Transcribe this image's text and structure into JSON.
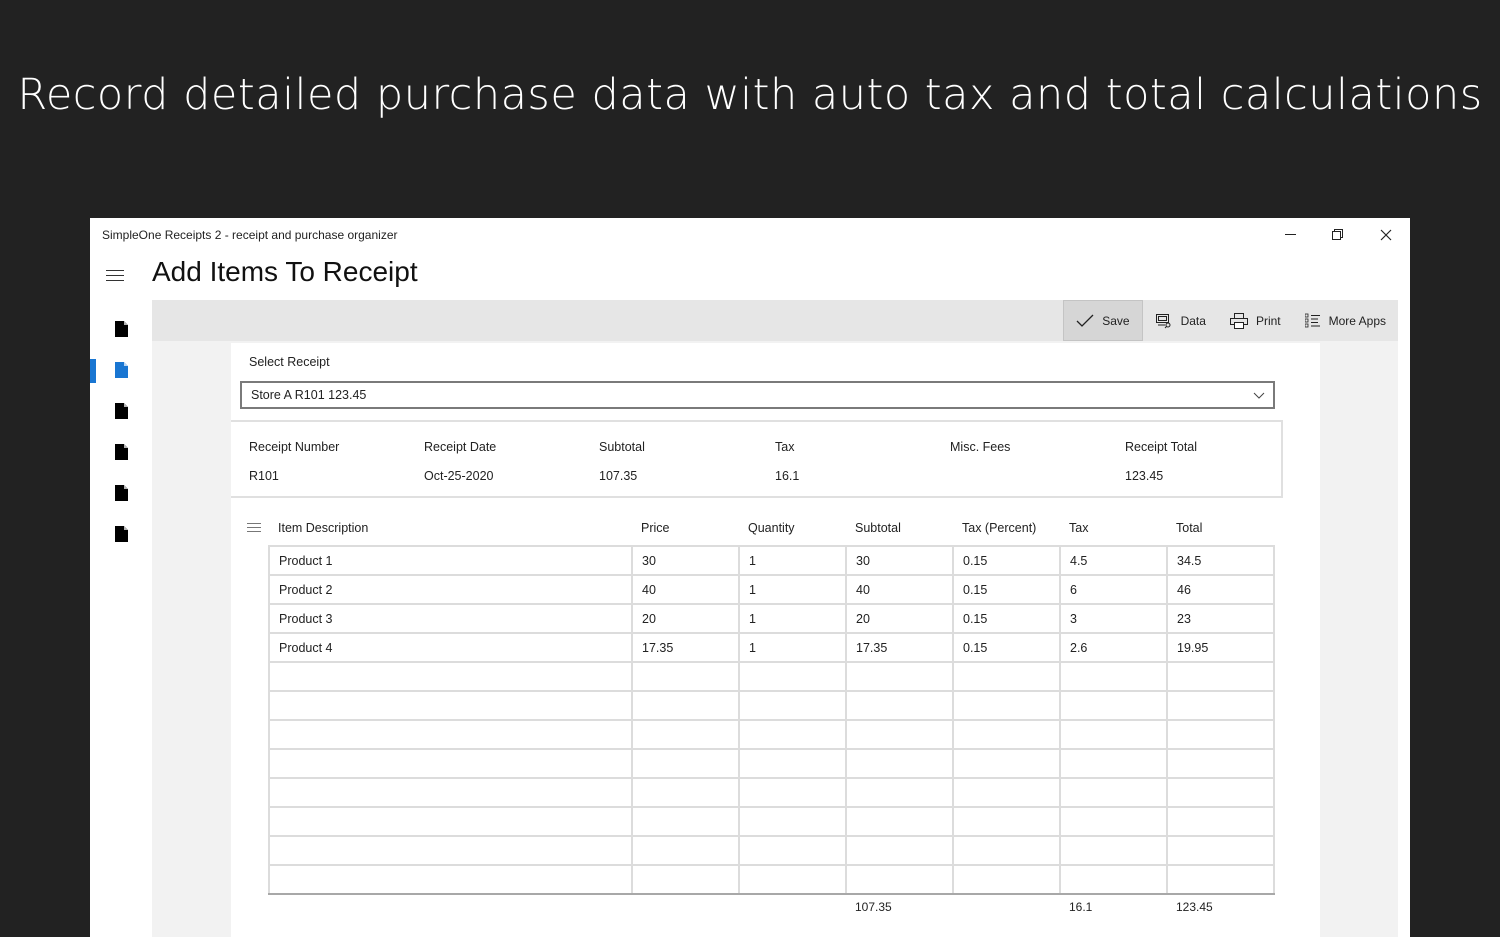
{
  "headline": "Record detailed purchase data with auto tax and total calculations",
  "window": {
    "title": "SimpleOne Receipts 2 - receipt and purchase organizer",
    "controls": {
      "minimize": "—",
      "restore": "❐",
      "close": "✕"
    }
  },
  "page": {
    "title": "Add Items To Receipt"
  },
  "nav": {
    "items": [
      {
        "icon": "document-icon",
        "active": false
      },
      {
        "icon": "document-icon",
        "active": true
      },
      {
        "icon": "document-icon",
        "active": false
      },
      {
        "icon": "document-icon",
        "active": false
      },
      {
        "icon": "document-icon",
        "active": false
      },
      {
        "icon": "document-icon",
        "active": false
      }
    ],
    "accent_color": "#1976d2"
  },
  "toolbar": {
    "save_label": "Save",
    "data_label": "Data",
    "print_label": "Print",
    "more_apps_label": "More Apps"
  },
  "select_receipt": {
    "label": "Select Receipt",
    "value": "Store A R101 123.45"
  },
  "summary": {
    "headers": [
      "Receipt Number",
      "Receipt Date",
      "Subtotal",
      "Tax",
      "Misc. Fees",
      "Receipt Total"
    ],
    "values": [
      "R101",
      "Oct-25-2020",
      "107.35",
      "16.1",
      "",
      "123.45"
    ]
  },
  "items_grid": {
    "headers": [
      "Item Description",
      "Price",
      "Quantity",
      "Subtotal",
      "Tax (Percent)",
      "Tax",
      "Total"
    ],
    "rows": [
      [
        "Product 1",
        "30",
        "1",
        "30",
        "0.15",
        "4.5",
        "34.5"
      ],
      [
        "Product 2",
        "40",
        "1",
        "40",
        "0.15",
        "6",
        "46"
      ],
      [
        "Product 3",
        "20",
        "1",
        "20",
        "0.15",
        "3",
        "23"
      ],
      [
        "Product 4",
        "17.35",
        "1",
        "17.35",
        "0.15",
        "2.6",
        "19.95"
      ],
      [
        "",
        "",
        "",
        "",
        "",
        "",
        ""
      ],
      [
        "",
        "",
        "",
        "",
        "",
        "",
        ""
      ],
      [
        "",
        "",
        "",
        "",
        "",
        "",
        ""
      ],
      [
        "",
        "",
        "",
        "",
        "",
        "",
        ""
      ],
      [
        "",
        "",
        "",
        "",
        "",
        "",
        ""
      ],
      [
        "",
        "",
        "",
        "",
        "",
        "",
        ""
      ],
      [
        "",
        "",
        "",
        "",
        "",
        "",
        ""
      ],
      [
        "",
        "",
        "",
        "",
        "",
        "",
        ""
      ]
    ],
    "footer": {
      "subtotal": "107.35",
      "tax": "16.1",
      "total": "123.45"
    }
  }
}
